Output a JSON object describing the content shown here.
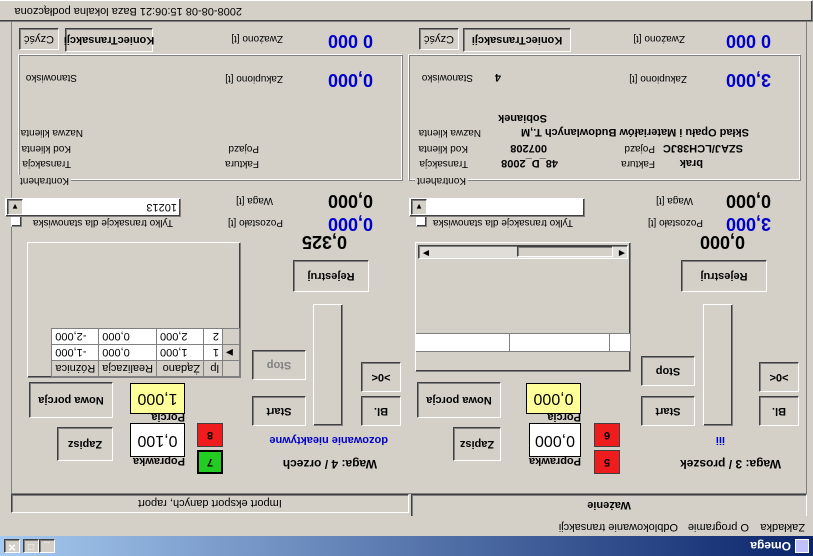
{
  "window": {
    "title": "Omega",
    "min": "_",
    "max": "□",
    "close": "✕"
  },
  "menu": [
    "Zakładka",
    "O programie",
    "Odblokowanie transakcji"
  ],
  "tabs": [
    "Ważenie",
    "Import eksport danych, raport"
  ],
  "status": "2008-08-08 15:06:21 Baza lokalna podłączona",
  "panels": [
    {
      "waga_label": "Waga:  3 / proszek",
      "poprawka_label": "Poprawka",
      "poprawka_value": "0,000",
      "porcja_label": "Porcja",
      "porcja_value": "0,000",
      "red1": "5",
      "red2": "6",
      "start": "Start",
      "stop": "Stop",
      "bl": "Bl.",
      "zero": ">0<",
      "zapisz": "Zapisz",
      "nowa_porcja": "Nowa porcja",
      "dozowanie": "iii",
      "rejestruj": "Rejestruj",
      "reading": "0,000",
      "tylko": "Tylko transakcje dla stanowiska",
      "combo_value": "",
      "pozostalo_label": "Pozostało [t]",
      "pozostalo_value": "0,000",
      "waga_t_label": "Waga [t]",
      "waga_t_value": "0,000",
      "kontrahent": "Kontrahent",
      "transakcja": "Transakcja",
      "transakcja_value": "",
      "faktura": "Faktura",
      "faktura_value": "",
      "kod_klienta": "Kod klienta",
      "kod_klienta_value": "",
      "pojazd": "Pojazd",
      "pojazd_value": "",
      "nazwa_klienta": "Nazwa klienta",
      "nazwa_line1": "",
      "nazwa_line2": "",
      "stanowisko": "Stanowisko",
      "stanowisko_value": "",
      "zakupiono_label": "Zakupiono [t]",
      "zakupiono_value": "0,000",
      "zwazono_label": "Zważono [t]",
      "zwazono_value": "0 000",
      "koniec": "KoniecTransakcji",
      "czysc": "Czyść"
    },
    {
      "waga_label": "Waga:  4 / orzech",
      "poprawka_label": "Poprawka",
      "poprawka_value": "0,100",
      "porcja_label": "Porcja",
      "porcja_value": "1,000",
      "red1": "7",
      "red2": "8",
      "start": "Start",
      "stop": "Stop",
      "bl": "Bl.",
      "zero": ">0<",
      "zapisz": "Zapisz",
      "nowa_porcja": "Nowa porcja",
      "dozowanie": "dozowanie nieaktywne",
      "rejestruj": "Rejestruj",
      "reading": "0,325",
      "tylko": "Tylko transakcje dla stanowiska",
      "combo_value": "10213",
      "pozostalo_label": "Pozostało [t]",
      "pozostalo_value": "3,000",
      "waga_t_label": "Waga [t]",
      "waga_t_value": "0,000",
      "kontrahent": "Kontrahent",
      "transakcja": "Transakcja",
      "transakcja_value": "48_D_2008",
      "faktura": "Faktura",
      "faktura_value": "brak",
      "kod_klienta": "Kod klienta",
      "kod_klienta_value": "007208",
      "pojazd": "Pojazd",
      "pojazd_value": "SZAJ/LCH38JC",
      "nazwa_klienta": "Nazwa klienta",
      "nazwa_line1": "Skład Opału i Materiałów Budowlanych T.,M",
      "nazwa_line2": "Sobianek",
      "stanowisko": "Stanowisko",
      "stanowisko_value": "4",
      "zakupiono_label": "Zakupiono [t]",
      "zakupiono_value": "3,000",
      "zwazono_label": "Zważono [t]",
      "zwazono_value": "0 000",
      "koniec": "KoniecTransakcji",
      "czysc": "Czyść"
    }
  ],
  "grid": {
    "headers": [
      "lp",
      "Żądano",
      "Realizacja",
      "Różnica"
    ],
    "rows": [
      [
        "1",
        "1,000",
        "0,000",
        "-1,000"
      ],
      [
        "2",
        "2,000",
        "0,000",
        "-2,000"
      ]
    ],
    "current_row_marker": "▶"
  },
  "arrows": {
    "down": "▼",
    "left": "◀",
    "right": "▶"
  }
}
